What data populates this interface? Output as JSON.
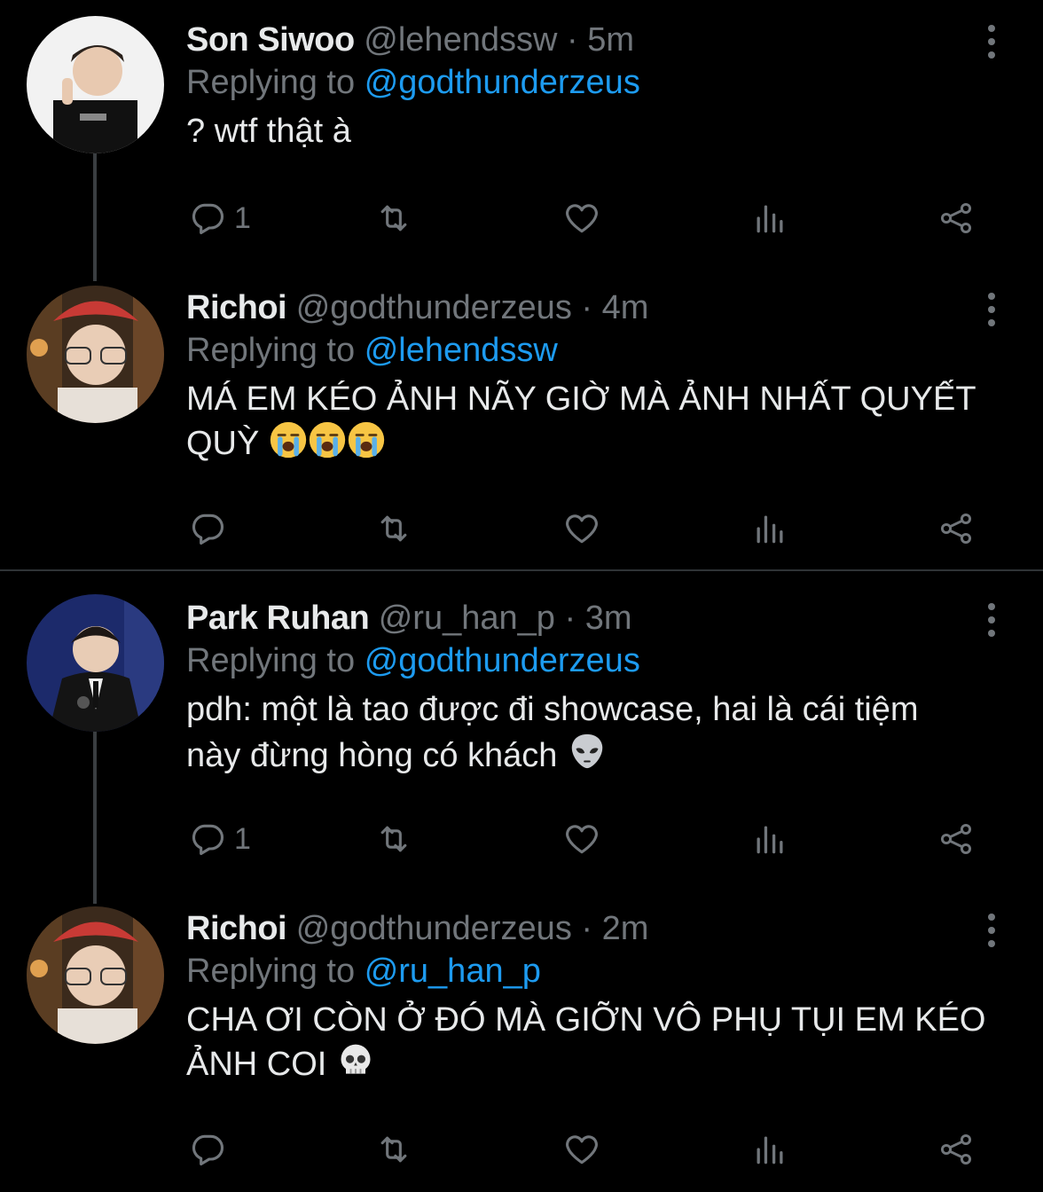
{
  "colors": {
    "background": "#000000",
    "text": "#e7e9ea",
    "muted": "#71767b",
    "link": "#1d9bf0"
  },
  "tweets": [
    {
      "name": "Son Siwoo",
      "handle": "@lehendssw",
      "dot": "·",
      "time": "5m",
      "replying_prefix": "Replying to",
      "replying_to": "@godthunderzeus",
      "text_lines": [
        "? wtf thật à"
      ],
      "emoji": [],
      "reply_count": "1"
    },
    {
      "name": "Richoi",
      "handle": "@godthunderzeus",
      "dot": "·",
      "time": "4m",
      "replying_prefix": "Replying to",
      "replying_to": "@lehendssw",
      "text_lines": [
        "MÁ EM KÉO ẢNH NÃY GIỜ MÀ ẢNH NHẤT QUYẾT",
        "QUỲ"
      ],
      "emoji": [
        "loudly-crying-face",
        "loudly-crying-face",
        "loudly-crying-face"
      ],
      "reply_count": ""
    },
    {
      "name": "Park Ruhan",
      "handle": "@ru_han_p",
      "dot": "·",
      "time": "3m",
      "replying_prefix": "Replying to",
      "replying_to": "@godthunderzeus",
      "text_lines": [
        "pdh: một là tao được đi showcase, hai là cái tiệm",
        "này đừng hòng có khách"
      ],
      "emoji": [
        "alien-face"
      ],
      "reply_count": "1"
    },
    {
      "name": "Richoi",
      "handle": "@godthunderzeus",
      "dot": "·",
      "time": "2m",
      "replying_prefix": "Replying to",
      "replying_to": "@ru_han_p",
      "text_lines": [
        "CHA ƠI CÒN Ở ĐÓ MÀ GIỠN VÔ PHỤ TỤI EM KÉO",
        "ẢNH COI"
      ],
      "emoji": [
        "skull"
      ],
      "reply_count": ""
    }
  ],
  "icons": [
    "reply-icon",
    "retweet-icon",
    "like-icon",
    "analytics-icon",
    "share-icon",
    "more-icon"
  ]
}
